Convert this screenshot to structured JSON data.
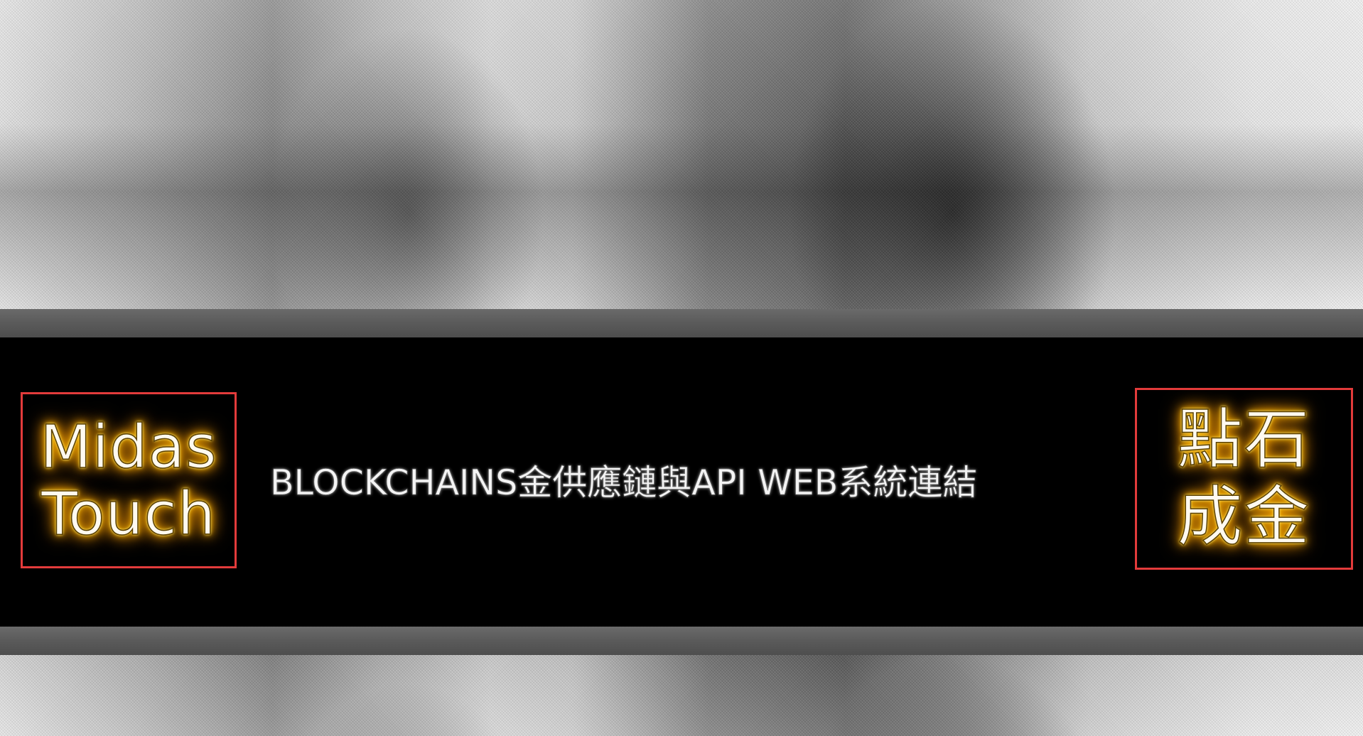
{
  "banner": {
    "headline": "BLOCKCHAINS金供應鏈與API WEB系統連結",
    "logo_left": {
      "line1": "Midas",
      "line2": "Touch"
    },
    "logo_right": {
      "line1": "點石",
      "line2": "成金"
    }
  },
  "colors": {
    "box_border": "#e33b3b",
    "glow": "#ffb300",
    "banner_bg": "#000000",
    "rail": "#5a5a5a"
  }
}
